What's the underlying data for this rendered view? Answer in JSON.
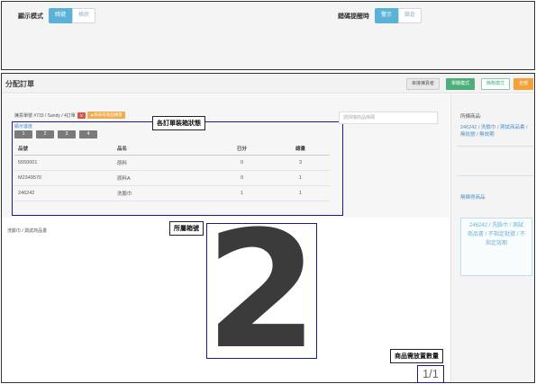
{
  "top_panel": {
    "display_mode_label": "顯示模式",
    "display_mode_options": [
      "暗號",
      "格狀"
    ],
    "display_mode_selected": 0,
    "error_prompt_label": "錯碼提醒時",
    "error_prompt_options": [
      "警示",
      "鎖倉"
    ],
    "error_prompt_selected": 0
  },
  "window": {
    "title": "分配訂單",
    "header_buttons": [
      "串接揀貨者",
      "單機模式",
      "簡略模式",
      "全部"
    ]
  },
  "order_info": {
    "text": "揀貨單號 #733 / Sandy / 4訂單",
    "tag_x": "X",
    "tag_status": "▲尚未有商品揀貨"
  },
  "annotations": {
    "order_status": "各訂單裝箱狀態",
    "box_number": "所屬箱號",
    "quantity_needed": "商品需放置數量"
  },
  "sort": {
    "label": "顯示進度",
    "pages": [
      "1",
      "2",
      "3",
      "4"
    ]
  },
  "table": {
    "headers": [
      "品號",
      "品名",
      "已分",
      "總量"
    ],
    "rows": [
      [
        "5550001",
        "原料",
        "0",
        "3"
      ],
      [
        "M2349570",
        "原料A",
        "0",
        "1"
      ],
      [
        "246242",
        "洗臉巾",
        "1",
        "1"
      ]
    ]
  },
  "search": {
    "placeholder": "請掃描商品條碼"
  },
  "product_label": "洗臉巾 / 測試商品書",
  "box_number": "2",
  "quantity": "1/1",
  "sidebar": {
    "products_label": "所揀商品:",
    "product_link": "246242 / 洗臉巾 / 測試商品書 / 無批號 / 無效期",
    "no_stock_link": "無揀得商品",
    "card_text": "246242 / 洗臉巾 / 測試商品書 / 不指定批號 / 不指定效期"
  }
}
